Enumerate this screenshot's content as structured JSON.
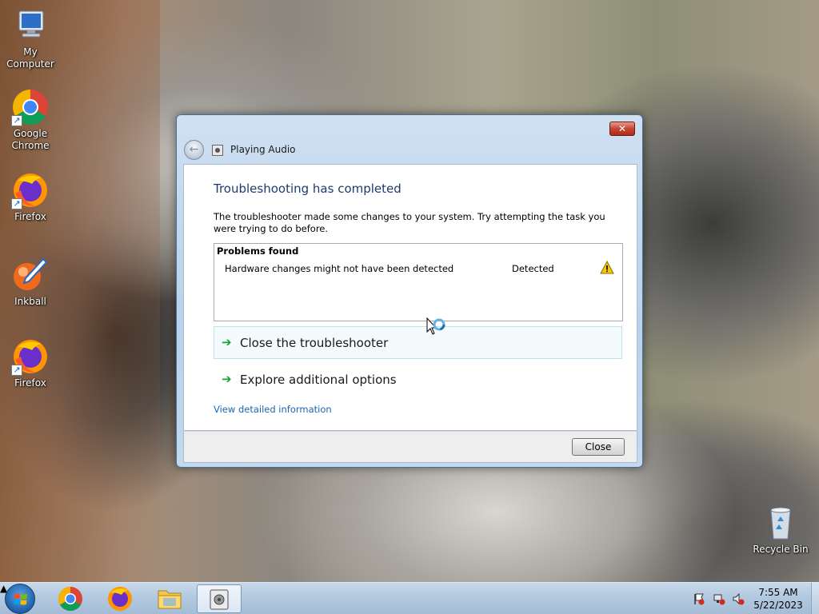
{
  "desktop": {
    "icons": [
      {
        "label": "My Computer"
      },
      {
        "label": "Google Chrome"
      },
      {
        "label": "Firefox"
      },
      {
        "label": "Inkball"
      },
      {
        "label": "Firefox"
      },
      {
        "label": "Recycle Bin"
      }
    ]
  },
  "window": {
    "title": "Playing Audio",
    "close_glyph": "✕",
    "heading": "Troubleshooting has completed",
    "description": "The troubleshooter made some changes to your system. Try attempting the task you were trying to do before.",
    "problems": {
      "header": "Problems found",
      "items": [
        {
          "name": "Hardware changes might not have been detected",
          "status": "Detected",
          "icon": "warning-icon"
        }
      ]
    },
    "commands": [
      {
        "label": "Close the troubleshooter",
        "icon": "green-arrow-icon"
      },
      {
        "label": "Explore additional options",
        "icon": "green-arrow-icon"
      }
    ],
    "detail_link": "View detailed information",
    "close_button": "Close"
  },
  "taskbar": {
    "apps": [
      "chrome-icon",
      "firefox-icon",
      "file-explorer-icon",
      "troubleshooter-icon"
    ],
    "tray": {
      "time": "7:55 AM",
      "date": "5/22/2023"
    }
  },
  "colors": {
    "heading": "#1e3a6e",
    "link": "#1b65b3",
    "arrow": "#1aa32c",
    "warning": "#f2c811"
  }
}
